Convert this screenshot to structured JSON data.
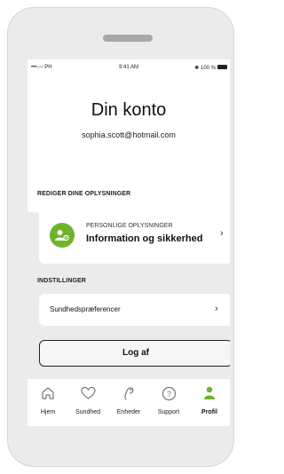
{
  "status_bar": {
    "carrier": "•••○○ PH",
    "time": "9:41 AM",
    "battery": "100 %"
  },
  "header": {
    "title": "Din konto",
    "email": "sophia.scott@hotmail.com"
  },
  "personal_section": {
    "heading": "REDIGER DINE OPLYSNINGER",
    "card_small": "PERSONLIGE OPLYSNINGER",
    "card_title": "Information og sikkerhed"
  },
  "settings_section": {
    "heading": "INDSTILLINGER",
    "item_label": "Sundhedspræferencer"
  },
  "logout_label": "Log af",
  "tabs": [
    {
      "label": "Hjem",
      "icon": "home-icon"
    },
    {
      "label": "Sundhed",
      "icon": "heart-icon"
    },
    {
      "label": "Enheder",
      "icon": "hearing-aid-icon"
    },
    {
      "label": "Support",
      "icon": "question-icon"
    },
    {
      "label": "Profil",
      "icon": "person-icon",
      "active": true
    }
  ],
  "colors": {
    "accent": "#6eb32a",
    "background": "#ebebeb",
    "card": "#ffffff"
  }
}
